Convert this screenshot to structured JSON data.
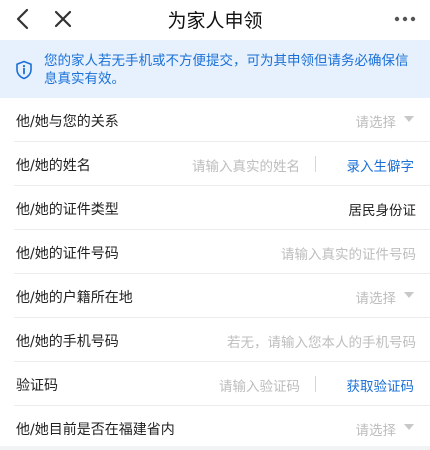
{
  "nav": {
    "title": "为家人申领"
  },
  "notice": {
    "text": "您的家人若无手机或不方便提交，可为其申领但请务必确保信息真实有效。"
  },
  "form": {
    "relation_label": "他/她与您的关系",
    "relation_placeholder": "请选择",
    "name_label": "他/她的姓名",
    "name_placeholder": "请输入真实的姓名",
    "name_action": "录入生僻字",
    "id_type_label": "他/她的证件类型",
    "id_type_value": "居民身份证",
    "id_number_label": "他/她的证件号码",
    "id_number_placeholder": "请输入真实的证件号码",
    "household_label": "他/她的户籍所在地",
    "household_placeholder": "请选择",
    "phone_label": "他/她的手机号码",
    "phone_placeholder": "若无，请输入您本人的手机号码",
    "code_label": "验证码",
    "code_placeholder": "请输入验证码",
    "code_action": "获取验证码",
    "in_fujian_label": "他/她目前是否在福建省内",
    "in_fujian_placeholder": "请选择"
  },
  "colors": {
    "accent": "#1a70d8",
    "notice_bg": "#e6f1fd",
    "placeholder": "#bdbdbd"
  },
  "icons": {
    "back": "chevron-left-icon",
    "close": "close-icon",
    "more": "more-dots-icon",
    "notice": "shield-info-icon",
    "select": "caret-down-icon"
  }
}
